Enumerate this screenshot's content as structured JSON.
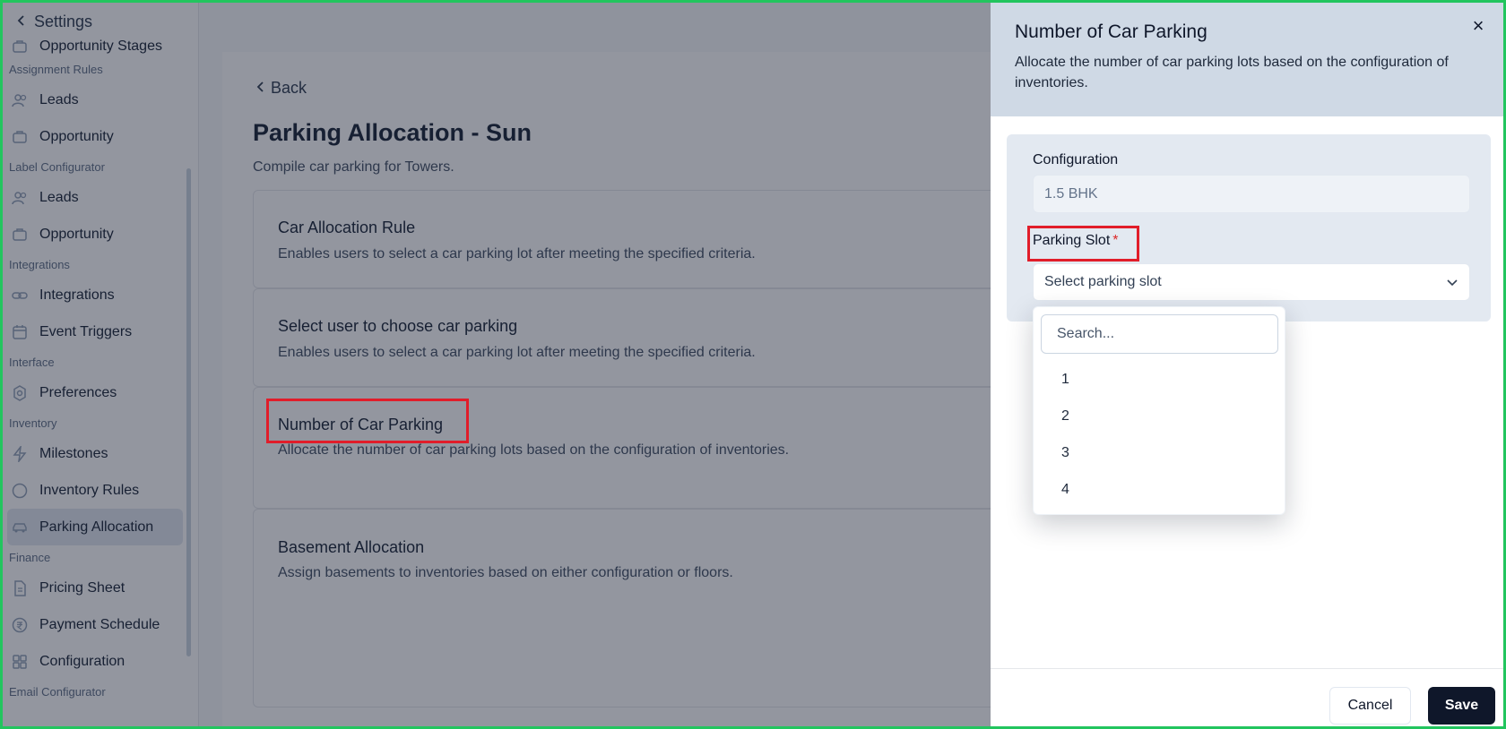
{
  "sidebar": {
    "title": "Settings",
    "items": [
      {
        "type": "item",
        "label": "Opportunity Stages",
        "icon": "briefcase-icon"
      },
      {
        "type": "group",
        "label": "Assignment Rules"
      },
      {
        "type": "item",
        "label": "Leads",
        "icon": "users-icon"
      },
      {
        "type": "item",
        "label": "Opportunity",
        "icon": "briefcase-icon"
      },
      {
        "type": "group",
        "label": "Label Configurator"
      },
      {
        "type": "item",
        "label": "Leads",
        "icon": "users-icon"
      },
      {
        "type": "item",
        "label": "Opportunity",
        "icon": "briefcase-icon"
      },
      {
        "type": "group",
        "label": "Integrations"
      },
      {
        "type": "item",
        "label": "Integrations",
        "icon": "link-icon"
      },
      {
        "type": "item",
        "label": "Event Triggers",
        "icon": "calendar-icon"
      },
      {
        "type": "group",
        "label": "Interface"
      },
      {
        "type": "item",
        "label": "Preferences",
        "icon": "gear-icon"
      },
      {
        "type": "group",
        "label": "Inventory"
      },
      {
        "type": "item",
        "label": "Milestones",
        "icon": "bolt-icon"
      },
      {
        "type": "item",
        "label": "Inventory Rules",
        "icon": "circle-icon"
      },
      {
        "type": "item",
        "label": "Parking Allocation",
        "icon": "car-icon",
        "active": true
      },
      {
        "type": "group",
        "label": "Finance"
      },
      {
        "type": "item",
        "label": "Pricing Sheet",
        "icon": "file-icon"
      },
      {
        "type": "item",
        "label": "Payment Schedule",
        "icon": "rupee-icon"
      },
      {
        "type": "item",
        "label": "Configuration",
        "icon": "grid-icon"
      },
      {
        "type": "group",
        "label": "Email Configurator"
      }
    ]
  },
  "main": {
    "back_label": "Back",
    "title": "Parking Allocation - Sun",
    "subtitle": "Compile car parking for Towers.",
    "cards": [
      {
        "title": "Car Allocation Rule",
        "desc": "Enables users to select a car parking lot after meeting the specified criteria."
      },
      {
        "title": "Select user to choose car parking",
        "desc": "Enables users to select a car parking lot after meeting the specified criteria."
      },
      {
        "title": "Number of Car Parking",
        "desc": "Allocate the number of car parking lots based on the configuration of inventories."
      },
      {
        "title": "Basement Allocation",
        "desc": "Assign basements to inventories based on either configuration or floors."
      }
    ]
  },
  "drawer": {
    "title": "Number of Car Parking",
    "desc": "Allocate the number of car parking lots based on the configuration of inventories.",
    "close_label": "×",
    "configuration_label": "Configuration",
    "configuration_value": "1.5 BHK",
    "parking_slot_label": "Parking Slot",
    "required_mark": "*",
    "select_placeholder": "Select parking slot",
    "search_placeholder": "Search...",
    "options": [
      "1",
      "2",
      "3",
      "4"
    ],
    "cancel_label": "Cancel",
    "save_label": "Save"
  }
}
